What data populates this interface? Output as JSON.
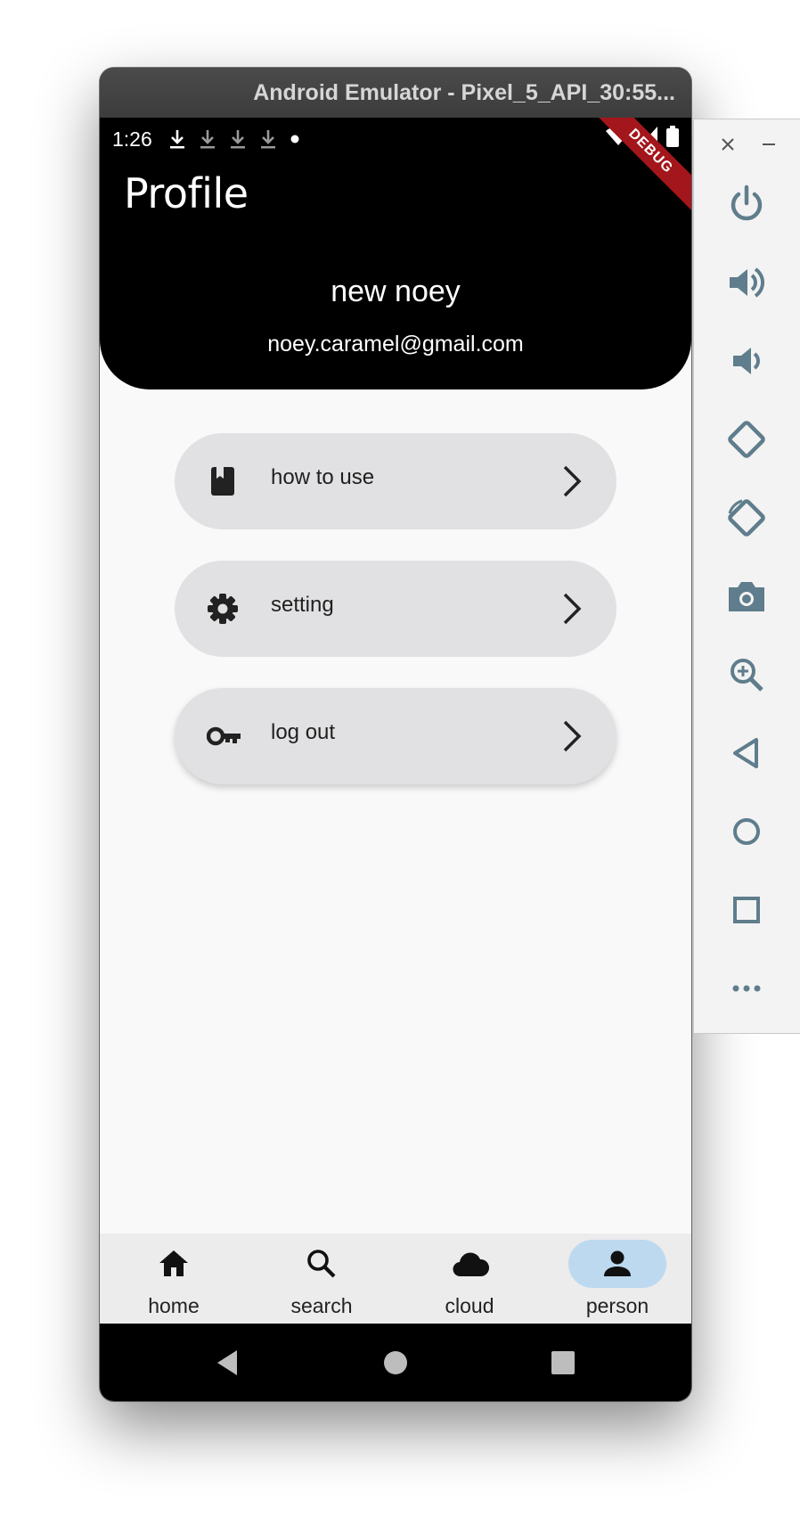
{
  "window": {
    "title": "Android Emulator - Pixel_5_API_30:55..."
  },
  "statusbar": {
    "time": "1:26",
    "ribbon": "DEBUG"
  },
  "header": {
    "title": "Profile",
    "user_name": "new noey",
    "user_email": "noey.caramel@gmail.com"
  },
  "menu": {
    "items": [
      {
        "label": "how to use",
        "icon": "book-icon"
      },
      {
        "label": "setting",
        "icon": "gear-icon"
      },
      {
        "label": "log out",
        "icon": "key-icon"
      }
    ]
  },
  "bottom_nav": {
    "items": [
      {
        "label": "home",
        "icon": "home-icon"
      },
      {
        "label": "search",
        "icon": "search-icon"
      },
      {
        "label": "cloud",
        "icon": "cloud-icon"
      },
      {
        "label": "person",
        "icon": "person-icon",
        "selected": true
      }
    ],
    "selected_color": "#bcd9ef"
  },
  "toolbar": {
    "buttons": [
      "power-icon",
      "volume-up-icon",
      "volume-down-icon",
      "rotate-left-icon",
      "rotate-right-icon",
      "camera-icon",
      "zoom-icon",
      "back-icon",
      "home-icon",
      "overview-icon",
      "more-icon"
    ],
    "icon_color": "#5f7d8c"
  },
  "colors": {
    "header_bg": "#000000",
    "menu_bg": "#e1e1e3",
    "screen_bg": "#f9f9f9",
    "nav_bg": "#ececec"
  }
}
